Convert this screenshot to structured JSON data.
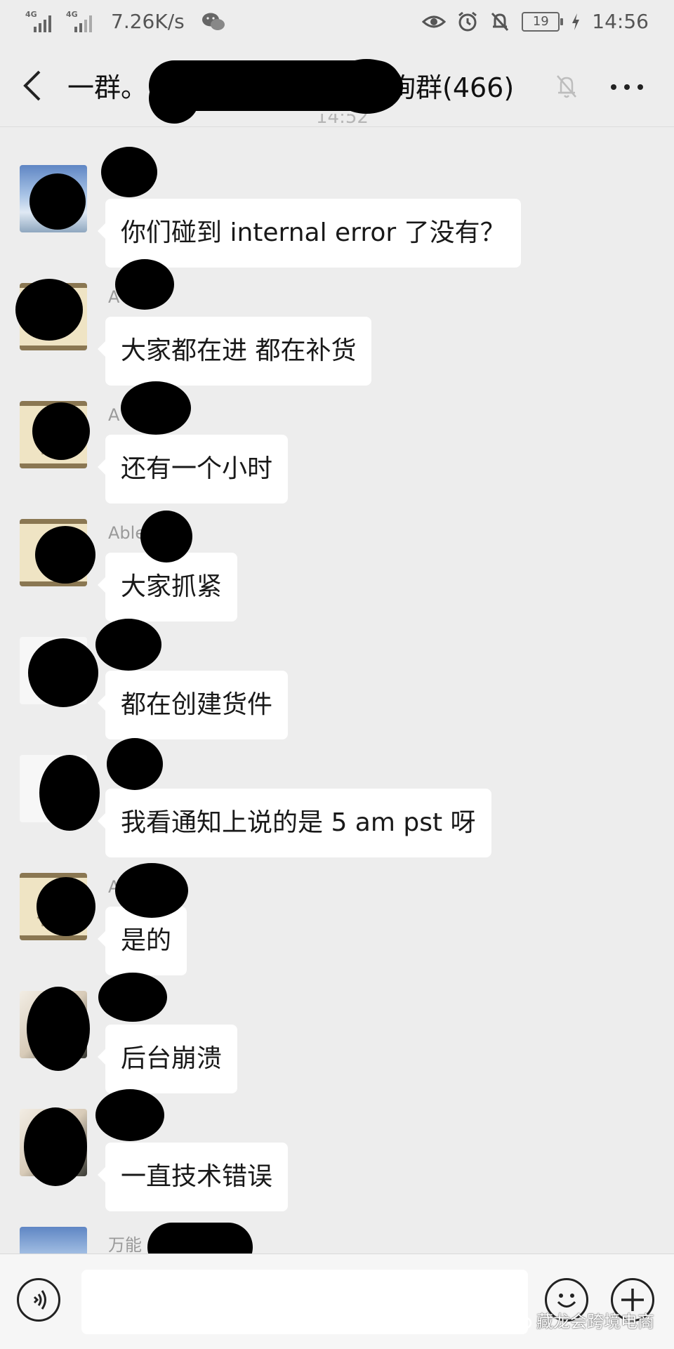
{
  "status_bar": {
    "net_tag_1": "4G",
    "net_tag_2": "4G",
    "speed": "7.26K/s",
    "battery": "19",
    "time": "14:56",
    "icons": [
      "signal-icon",
      "wechat-icon",
      "eye-icon",
      "alarm-icon",
      "mute-bell-icon",
      "battery-icon",
      "charging-icon"
    ]
  },
  "title_bar": {
    "title_start": "一群。",
    "title_end": "询群(466)",
    "peek_time": "14:52",
    "icons": [
      "back-arrow-icon",
      "mute-bell-icon",
      "more-icon"
    ]
  },
  "messages": [
    {
      "sender": "",
      "text": "你们碰到 internal error 了没有？",
      "avatar": "sky"
    },
    {
      "sender": "A      n",
      "text": "大家都在进 都在补货",
      "avatar": "scroll"
    },
    {
      "sender": "A",
      "text": "还有一个小时",
      "avatar": "scroll"
    },
    {
      "sender": "Able",
      "text": "大家抓紧",
      "avatar": "scroll"
    },
    {
      "sender": "",
      "text": "都在创建货件",
      "avatar": "white"
    },
    {
      "sender": "",
      "text": "我看通知上说的是 5 am pst 呀",
      "avatar": "white"
    },
    {
      "sender": "A",
      "text": "是的",
      "avatar": "scroll"
    },
    {
      "sender": "",
      "text": "后台崩溃",
      "avatar": "photo"
    },
    {
      "sender": "",
      "text": "一直技术错误",
      "avatar": "photo"
    },
    {
      "sender": "万能",
      "text": "",
      "avatar": "sky"
    }
  ],
  "input_bar": {
    "placeholder": "",
    "icons": [
      "voice-icon",
      "emoji-icon",
      "plus-icon"
    ]
  },
  "watermark": {
    "text": "藏龙会跨境电商",
    "icon": "wechat-icon"
  },
  "colors": {
    "background": "#ededed",
    "bubble": "#ffffff",
    "text": "#191919",
    "muted": "#9a9a9a",
    "redaction": "#000000"
  }
}
